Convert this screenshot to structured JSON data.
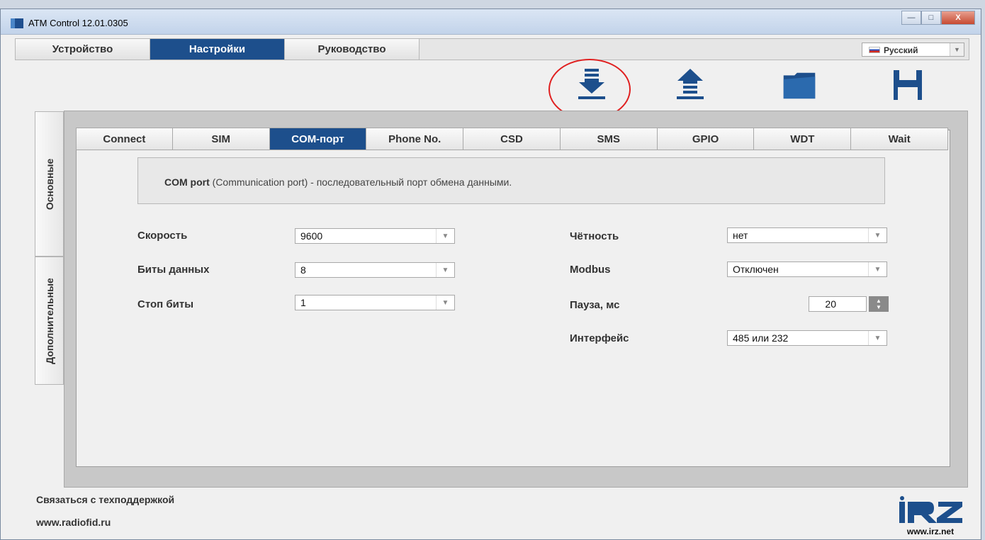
{
  "window": {
    "title": "ATM Control 12.01.0305",
    "minimize_glyph": "—",
    "maximize_glyph": "□",
    "close_glyph": "X"
  },
  "main_tabs": [
    "Устройство",
    "Настройки",
    "Руководство"
  ],
  "language": {
    "value": "Русский"
  },
  "toolbar": {
    "icons": [
      "download-arrow-icon",
      "upload-arrow-icon",
      "folder-icon",
      "save-floppy-icon"
    ],
    "accent_color": "#1d4f8c",
    "highlight_color": "#e02020"
  },
  "side_tabs": [
    "Основные",
    "Дополнительные"
  ],
  "sub_tabs": [
    "Connect",
    "SIM",
    "COM-порт",
    "Phone No.",
    "CSD",
    "SMS",
    "GPIO",
    "WDT",
    "Wait"
  ],
  "info": {
    "bold": "COM port",
    "text": " (Communication port) - последовательный порт обмена данными."
  },
  "fields": {
    "speed": {
      "label": "Скорость",
      "value": "9600"
    },
    "data_bits": {
      "label": "Биты данных",
      "value": "8"
    },
    "stop_bits": {
      "label": "Стоп биты",
      "value": "1"
    },
    "parity": {
      "label": "Чётность",
      "value": "нет"
    },
    "modbus": {
      "label": "Modbus",
      "value": "Отключен"
    },
    "pause": {
      "label": "Пауза, мс",
      "value": "20"
    },
    "interface": {
      "label": "Интерфейс",
      "value": "485 или 232"
    }
  },
  "footer": {
    "support": "Связаться с техподдержкой",
    "site": "www.radiofid.ru"
  },
  "logo": {
    "brand": "iRZ",
    "site": "www.irz.net"
  }
}
